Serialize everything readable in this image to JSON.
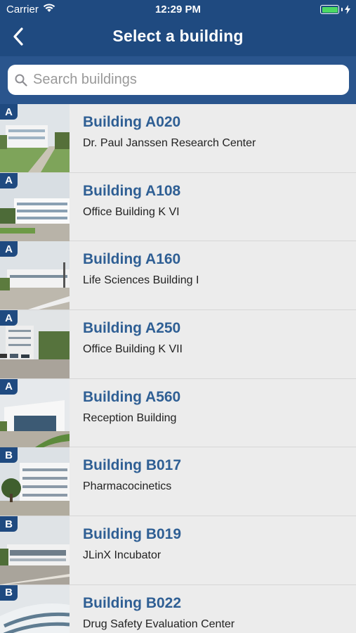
{
  "status_bar": {
    "carrier": "Carrier",
    "time": "12:29 PM"
  },
  "nav": {
    "title": "Select a building"
  },
  "search": {
    "placeholder": "Search buildings",
    "value": ""
  },
  "buildings": [
    {
      "badge": "A",
      "title": "Building A020",
      "subtitle": "Dr. Paul Janssen Research Center"
    },
    {
      "badge": "A",
      "title": "Building A108",
      "subtitle": "Office Building K VI"
    },
    {
      "badge": "A",
      "title": "Building A160",
      "subtitle": "Life Sciences Building I"
    },
    {
      "badge": "A",
      "title": "Building A250",
      "subtitle": "Office Building K VII"
    },
    {
      "badge": "A",
      "title": "Building A560",
      "subtitle": "Reception Building"
    },
    {
      "badge": "B",
      "title": "Building B017",
      "subtitle": "Pharmacocinetics"
    },
    {
      "badge": "B",
      "title": "Building B019",
      "subtitle": "JLinX Incubator"
    },
    {
      "badge": "B",
      "title": "Building B022",
      "subtitle": "Drug Safety Evaluation Center"
    }
  ]
}
